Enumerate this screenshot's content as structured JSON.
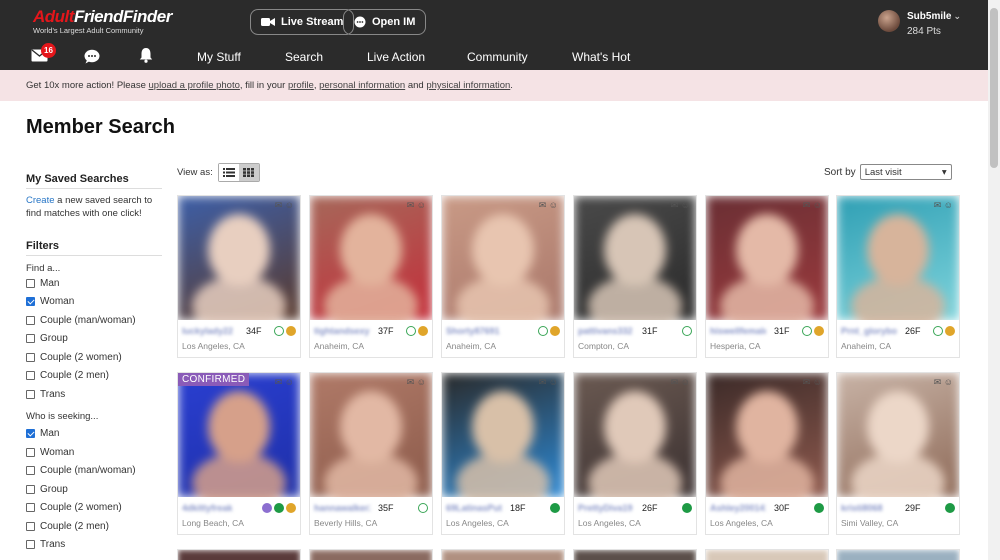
{
  "header": {
    "logo": "AdultFriendFinder",
    "logo_tagline": "World's Largest Adult Community",
    "live_stream": "Live Stream",
    "open_im": "Open IM",
    "username": "Sub5mile",
    "points": "284 Pts",
    "mail_badge": "16"
  },
  "nav": {
    "my_stuff": "My Stuff",
    "search": "Search",
    "live_action": "Live Action",
    "community": "Community",
    "whats_hot": "What's Hot"
  },
  "notice": {
    "prefix": "Get 10x more action! Please",
    "link1": "upload a profile photo",
    "mid1": ", fill in your",
    "link2": "profile",
    "mid2": ",",
    "link3": "personal information",
    "mid3": "and",
    "link4": "physical information",
    "suffix": "."
  },
  "page_title": "Member Search",
  "sidebar": {
    "saved_title": "My Saved Searches",
    "create_link": "Create",
    "create_text": "a new saved search to find matches with one click!",
    "filters_title": "Filters",
    "find_label": "Find a...",
    "find_options": [
      {
        "label": "Man",
        "checked": false
      },
      {
        "label": "Woman",
        "checked": true
      },
      {
        "label": "Couple (man/woman)",
        "checked": false
      },
      {
        "label": "Group",
        "checked": false
      },
      {
        "label": "Couple (2 women)",
        "checked": false
      },
      {
        "label": "Couple (2 men)",
        "checked": false
      },
      {
        "label": "Trans",
        "checked": false
      }
    ],
    "seeking_label": "Who is seeking...",
    "seeking_options": [
      {
        "label": "Man",
        "checked": true
      },
      {
        "label": "Woman",
        "checked": false
      },
      {
        "label": "Couple (man/woman)",
        "checked": false
      },
      {
        "label": "Group",
        "checked": false
      },
      {
        "label": "Couple (2 women)",
        "checked": false
      },
      {
        "label": "Couple (2 men)",
        "checked": false
      },
      {
        "label": "Trans",
        "checked": false
      }
    ]
  },
  "toolbar": {
    "view_as": "View as:",
    "sort_by": "Sort by",
    "sort_value": "Last visit"
  },
  "results": [
    {
      "name": "luckylady22",
      "age": "34F",
      "location": "Los Angeles, CA",
      "colors": [
        "#3d5fa8",
        "#e8cfc0",
        "#5a3a2c"
      ],
      "icons": [
        "g",
        "c"
      ]
    },
    {
      "name": "tightandsexy",
      "age": "37F",
      "location": "Anaheim, CA",
      "colors": [
        "#a6685a",
        "#e3b39c",
        "#c42e3a"
      ],
      "icons": [
        "g",
        "c"
      ]
    },
    {
      "name": "Shorty87691",
      "age": "",
      "location": "Anaheim, CA",
      "colors": [
        "#c99a86",
        "#e8c5b0",
        "#a9776a"
      ],
      "icons": [
        "g",
        "c"
      ]
    },
    {
      "name": "pattivans332",
      "age": "31F",
      "location": "Compton, CA",
      "colors": [
        "#4a4a4a",
        "#d7c5b6",
        "#2a2a2a"
      ],
      "icons": [
        "g"
      ]
    },
    {
      "name": "hiswellfemale",
      "age": "31F",
      "location": "Hesperia, CA",
      "colors": [
        "#6a2f34",
        "#e4b9a7",
        "#9b3a3d"
      ],
      "icons": [
        "g",
        "c"
      ]
    },
    {
      "name": "Prnt_glorybox",
      "age": "26F",
      "location": "Anaheim, CA",
      "colors": [
        "#2f9fb4",
        "#d7b49b",
        "#7fd4dc"
      ],
      "icons": [
        "g",
        "c"
      ]
    },
    {
      "name": "4dkittyfreak",
      "age": "",
      "location": "Long Beach, CA",
      "colors": [
        "#2a3fd1",
        "#d6a08a",
        "#1e2fa8"
      ],
      "icons": [
        "p",
        "gf",
        "c"
      ],
      "confirmed": "CONFIRMED"
    },
    {
      "name": "hannawalker22",
      "age": "35F",
      "location": "Beverly Hills, CA",
      "colors": [
        "#b07a68",
        "#e2b8a4",
        "#8b5a4a"
      ],
      "icons": [
        "g"
      ]
    },
    {
      "name": "69LatinasPutalli",
      "age": "18F",
      "location": "Los Angeles, CA",
      "colors": [
        "#2a2a2a",
        "#d8c0a8",
        "#2d8ad6"
      ],
      "icons": [
        "gf"
      ]
    },
    {
      "name": "PrettyDiva19",
      "age": "26F",
      "location": "Los Angeles, CA",
      "colors": [
        "#6b5a52",
        "#e0c9b9",
        "#3a3030"
      ],
      "icons": [
        "gf"
      ]
    },
    {
      "name": "Ashley200141",
      "age": "30F",
      "location": "Los Angeles, CA",
      "colors": [
        "#3b2a28",
        "#e0b4a0",
        "#8f5a4e"
      ],
      "icons": [
        "gf"
      ]
    },
    {
      "name": "kristi8068",
      "age": "29F",
      "location": "Simi Valley, CA",
      "colors": [
        "#c8b3a6",
        "#ecd7c8",
        "#8e6a58"
      ],
      "icons": [
        "gf"
      ]
    }
  ]
}
